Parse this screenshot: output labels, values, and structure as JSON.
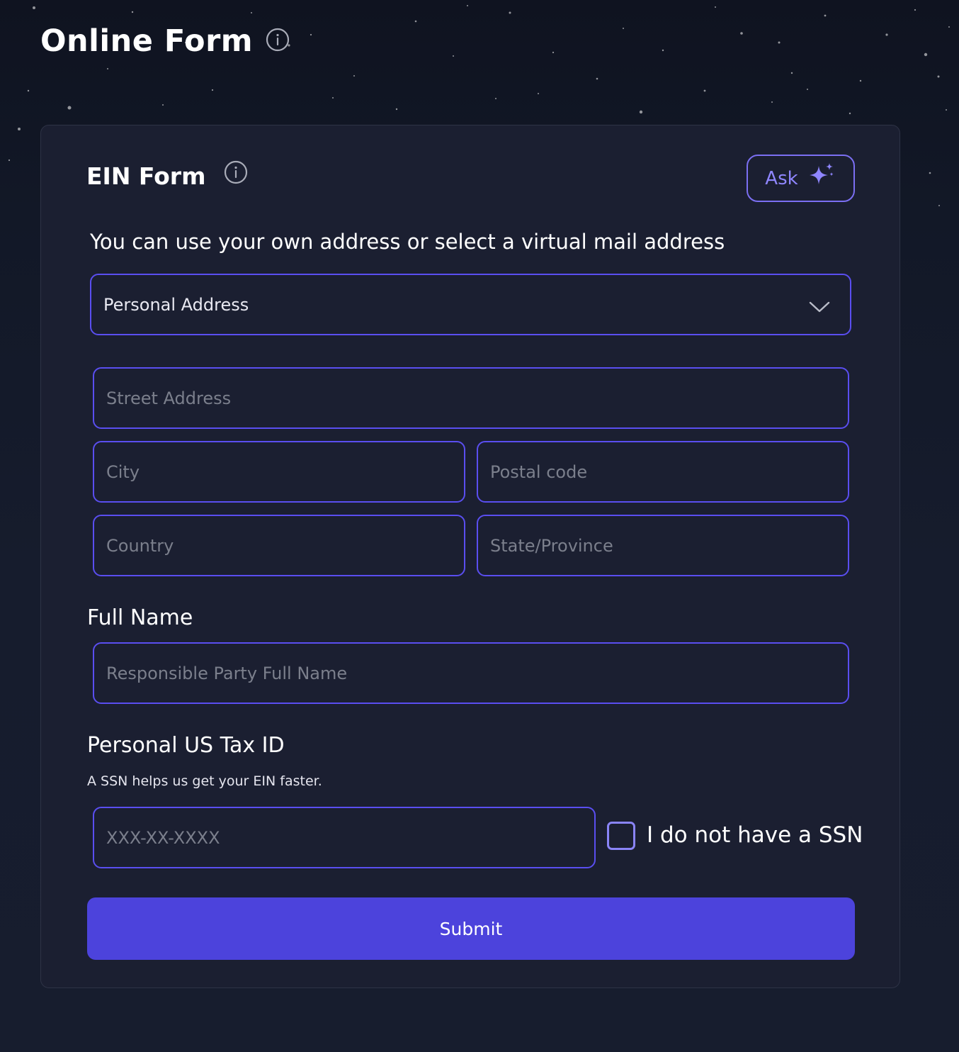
{
  "page": {
    "title": "Online Form"
  },
  "card": {
    "title": "EIN Form",
    "ask_label": "Ask",
    "lead_text": "You can use your own address or select a virtual mail address",
    "address_select": {
      "selected": "Personal Address"
    },
    "address_fields": {
      "street_placeholder": "Street Address",
      "city_placeholder": "City",
      "postal_placeholder": "Postal code",
      "country_placeholder": "Country",
      "state_placeholder": "State/Province"
    },
    "full_name": {
      "label": "Full Name",
      "placeholder": "Responsible Party Full Name"
    },
    "tax_id": {
      "label": "Personal US Tax ID",
      "hint": "A SSN helps us get your EIN faster.",
      "placeholder": "XXX-XX-XXXX",
      "no_ssn_label": "I do not have a SSN",
      "no_ssn_checked": false
    },
    "submit_label": "Submit"
  },
  "icons": {
    "info": "info-circle-icon",
    "sparkle": "sparkle-icon",
    "chevron": "chevron-down-icon"
  },
  "colors": {
    "accent": "#4c43dc",
    "border": "#5a4ef0",
    "ask_text": "#8f86ff",
    "card_bg": "#1b1f31",
    "page_bg": "#121827"
  }
}
